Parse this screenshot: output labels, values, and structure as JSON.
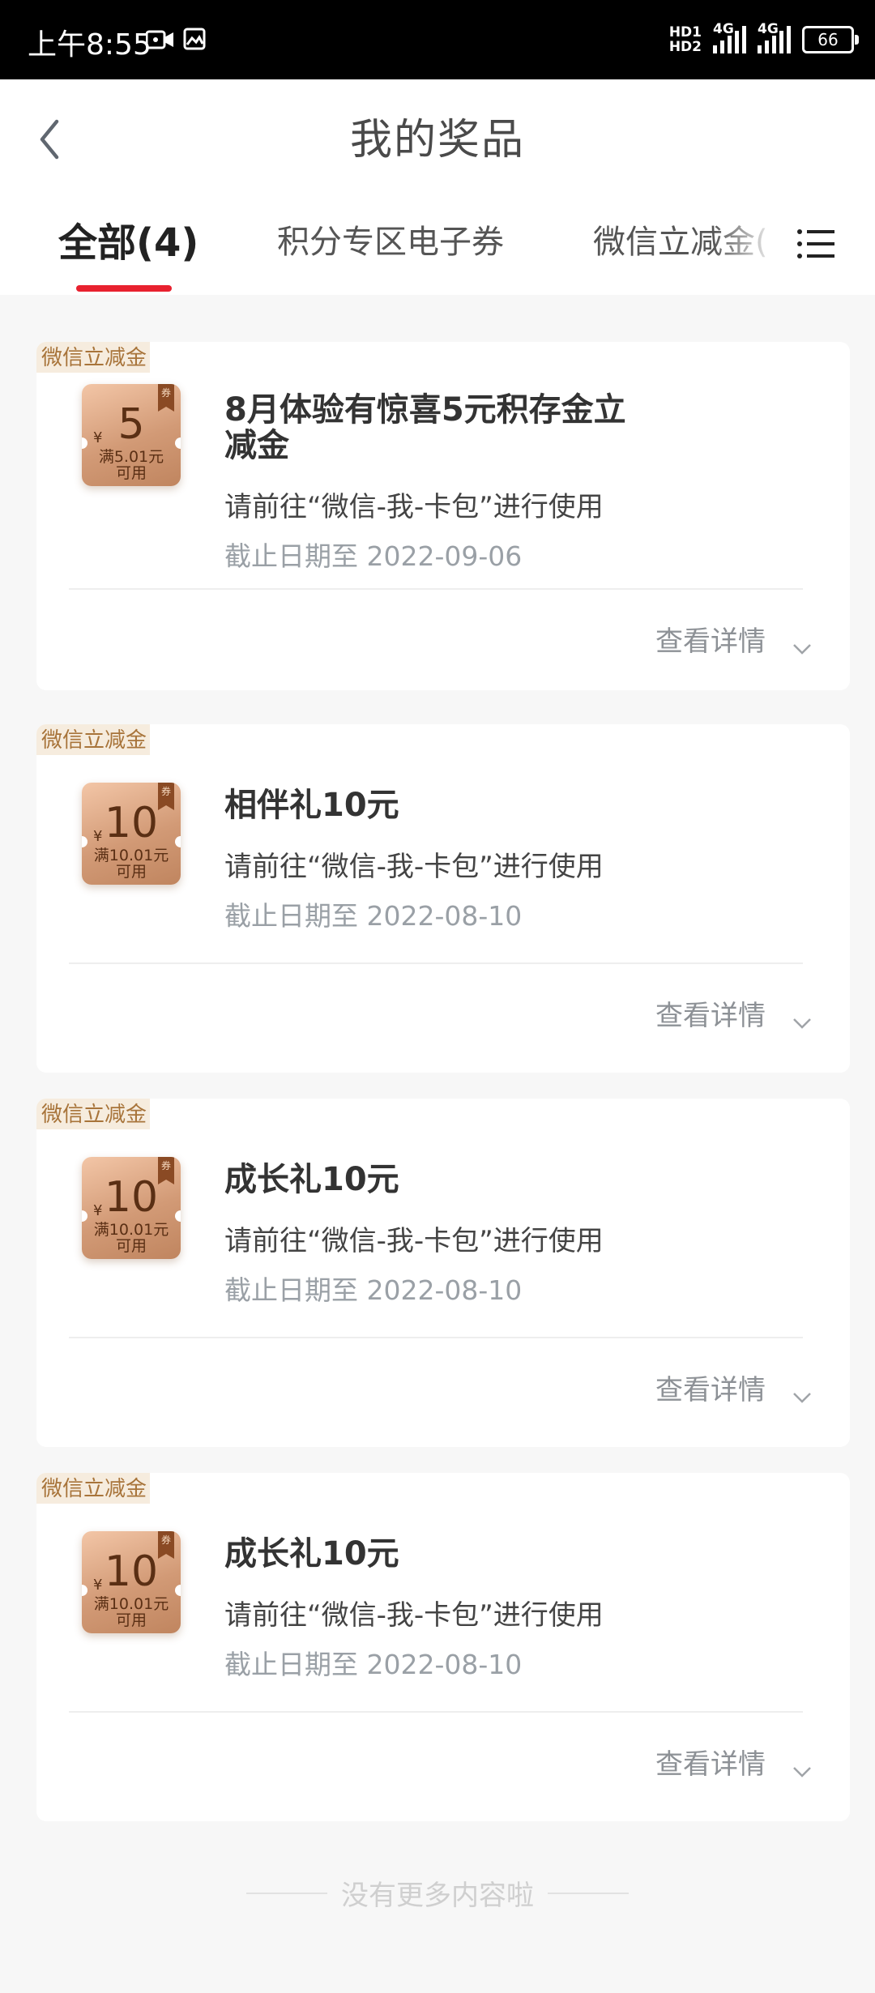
{
  "status_bar": {
    "time": "上午8:55",
    "hd1": "HD1",
    "hd2": "HD2",
    "net1": "4G",
    "net2": "4G",
    "battery": "66"
  },
  "header": {
    "title": "我的奖品",
    "back_icon": "chevron-left-icon"
  },
  "tabs": [
    {
      "label": "全部(4)",
      "active": true
    },
    {
      "label": "积分专区电子券",
      "active": false
    },
    {
      "label": "微信立减金(",
      "active": false
    }
  ],
  "tab_accent_color": "#e8212f",
  "menu_icon": "list-menu-icon",
  "cards": [
    {
      "type": "微信立减金",
      "coupon": {
        "currency": "¥",
        "amount": "5",
        "minimum": "满5.01元",
        "usable": "可用",
        "tag": "券"
      },
      "title": "8月体验有惊喜5元积存金立减金",
      "description": "请前往“微信-我-卡包”进行使用",
      "deadline": "截止日期至 2022-09-06",
      "detail_label": "查看详情"
    },
    {
      "type": "微信立减金",
      "coupon": {
        "currency": "¥",
        "amount": "10",
        "minimum": "满10.01元",
        "usable": "可用",
        "tag": "券"
      },
      "title": "相伴礼10元",
      "description": "请前往“微信-我-卡包”进行使用",
      "deadline": "截止日期至 2022-08-10",
      "detail_label": "查看详情"
    },
    {
      "type": "微信立减金",
      "coupon": {
        "currency": "¥",
        "amount": "10",
        "minimum": "满10.01元",
        "usable": "可用",
        "tag": "券"
      },
      "title": "成长礼10元",
      "description": "请前往“微信-我-卡包”进行使用",
      "deadline": "截止日期至 2022-08-10",
      "detail_label": "查看详情"
    },
    {
      "type": "微信立减金",
      "coupon": {
        "currency": "¥",
        "amount": "10",
        "minimum": "满10.01元",
        "usable": "可用",
        "tag": "券"
      },
      "title": "成长礼10元",
      "description": "请前往“微信-我-卡包”进行使用",
      "deadline": "截止日期至 2022-08-10",
      "detail_label": "查看详情"
    }
  ],
  "end_of_list": "没有更多内容啦"
}
